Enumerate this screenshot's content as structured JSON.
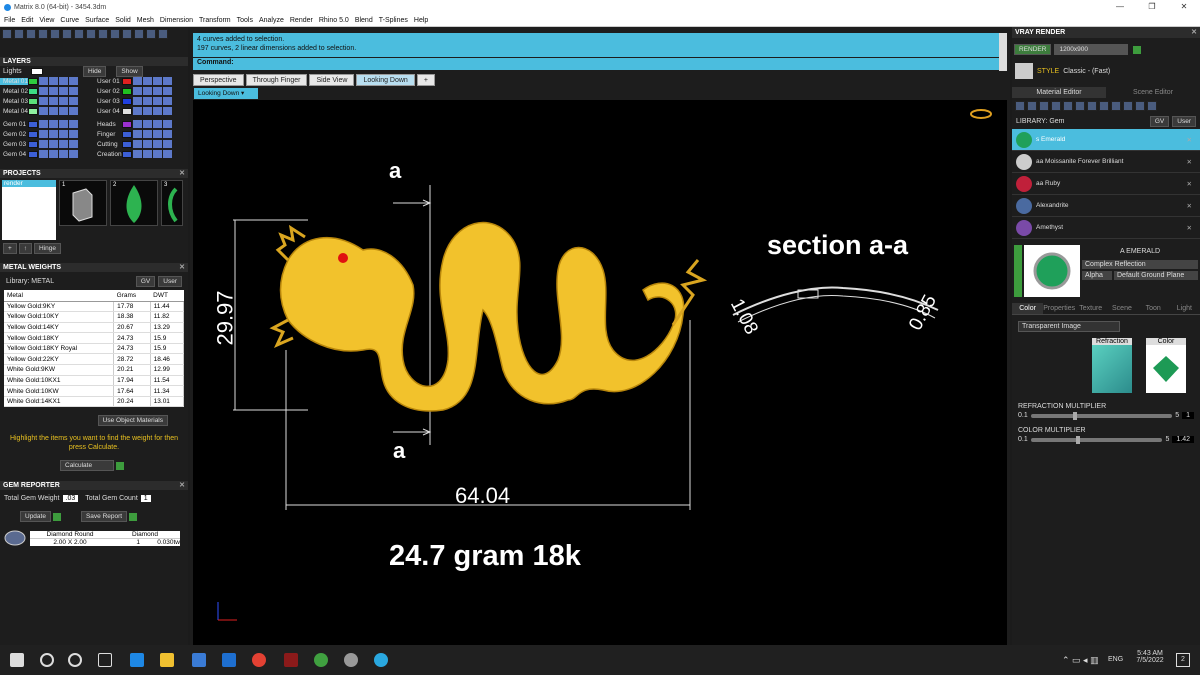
{
  "window": {
    "title": "Matrix 8.0 (64-bit) - 3454.3dm",
    "controls": [
      "—",
      "❐",
      "✕"
    ]
  },
  "menu": [
    "File",
    "Edit",
    "View",
    "Curve",
    "Surface",
    "Solid",
    "Mesh",
    "Dimension",
    "Transform",
    "Tools",
    "Analyze",
    "Render",
    "Rhino 5.0",
    "Blend",
    "T-Splines",
    "Help"
  ],
  "layers": {
    "title": "LAYERS",
    "lights_label": "Lights",
    "hide_label": "Hide",
    "show_label": "Show",
    "left": [
      {
        "name": "Metal 01",
        "color": "#2ecc40"
      },
      {
        "name": "Metal 02",
        "color": "#3ddc84"
      },
      {
        "name": "Metal 03",
        "color": "#5be07a"
      },
      {
        "name": "Metal 04",
        "color": "#8ff0a0"
      },
      {
        "name": "Gem 01",
        "color": "#3c5fd6"
      },
      {
        "name": "Gem 02",
        "color": "#3c5fd6"
      },
      {
        "name": "Gem 03",
        "color": "#3c5fd6"
      },
      {
        "name": "Gem 04",
        "color": "#3c5fd6"
      }
    ],
    "right": [
      {
        "name": "User 01",
        "color": "#e02020"
      },
      {
        "name": "User 02",
        "color": "#20c020"
      },
      {
        "name": "User 03",
        "color": "#2040e0"
      },
      {
        "name": "User 04",
        "color": "#e0e0e0"
      },
      {
        "name": "Heads",
        "color": "#9b30d0"
      },
      {
        "name": "Finger",
        "color": "#3c5fd6"
      },
      {
        "name": "Cutting",
        "color": "#3c5fd6"
      },
      {
        "name": "Creation",
        "color": "#3c5fd6"
      }
    ]
  },
  "projects": {
    "title": "PROJECTS",
    "item": "render",
    "thumbs": [
      "1",
      "2",
      "3"
    ],
    "hinge_label": "Hinge"
  },
  "metal_weights": {
    "title": "METAL WEIGHTS",
    "library_label": "Library: METAL",
    "gv_label": "GV",
    "user_label": "User",
    "columns": [
      "Metal",
      "Grams",
      "DWT"
    ],
    "rows": [
      [
        "Yellow Gold:9KY",
        "17.78",
        "11.44"
      ],
      [
        "Yellow Gold:10KY",
        "18.38",
        "11.82"
      ],
      [
        "Yellow Gold:14KY",
        "20.67",
        "13.29"
      ],
      [
        "Yellow Gold:18KY",
        "24.73",
        "15.9"
      ],
      [
        "Yellow Gold:18KY Royal",
        "24.73",
        "15.9"
      ],
      [
        "Yellow Gold:22KY",
        "28.72",
        "18.46"
      ],
      [
        "White Gold:9KW",
        "20.21",
        "12.99"
      ],
      [
        "White Gold:10KX1",
        "17.94",
        "11.54"
      ],
      [
        "White Gold:10KW",
        "17.64",
        "11.34"
      ],
      [
        "White Gold:14KX1",
        "20.24",
        "13.01"
      ]
    ],
    "use_object_materials": "Use Object Materials",
    "hint": "Highlight the items you want to find the weight for then press Calculate.",
    "calculate_label": "Calculate"
  },
  "gem_reporter": {
    "title": "GEM REPORTER",
    "total_weight_label": "Total Gem Weight",
    "total_weight_value": ".03",
    "total_count_label": "Total Gem Count",
    "total_count_value": "1",
    "update_label": "Update",
    "save_report_label": "Save Report",
    "gem": {
      "name": "Diamond Round",
      "type": "Diamond",
      "size": "2.00 X 2.00",
      "qty": "1",
      "weight": "0.030tw"
    }
  },
  "command": {
    "messages": [
      "4 curves added to selection.",
      "197 curves, 2 linear dimensions added to selection."
    ],
    "label": "Command:"
  },
  "viewport_tabs": [
    "Perspective",
    "Through Finger",
    "Side View",
    "Looking Down"
  ],
  "active_tab_index": 3,
  "viewport_label": "Looking Down",
  "drawing": {
    "label_a_top": "a",
    "label_a_bottom": "a",
    "height_dim": "29.97",
    "width_dim": "64.04",
    "section_title": "section a-a",
    "section_left_dim": "1.08",
    "section_right_dim": "0.85",
    "caption": "24.7 gram 18k",
    "dragon_color": "#f2c22c",
    "eye_color": "#e01010"
  },
  "vray": {
    "title": "VRAY RENDER",
    "render_label": "RENDER",
    "resolution": "1200x900",
    "style_label": "STYLE",
    "style_value": "Classic - (Fast)",
    "tabs": [
      "Material Editor",
      "Scene Editor"
    ],
    "library_label": "LIBRARY: Gem",
    "materials": [
      {
        "name": "s Emerald",
        "color": "#1fa05a",
        "selected": true
      },
      {
        "name": "aa Moissanite Forever Brilliant",
        "color": "#cccccc",
        "selected": false
      },
      {
        "name": "aa Ruby",
        "color": "#c0203a",
        "selected": false
      },
      {
        "name": "Alexandrite",
        "color": "#4a6aa0",
        "selected": false
      },
      {
        "name": "Amethyst",
        "color": "#7a4aa8",
        "selected": false
      }
    ],
    "selected_material": "A EMERALD",
    "reflection_type": "Complex Reflection",
    "alpha_label": "Alpha",
    "ground_plane": "Default Ground Plane",
    "prop_tabs": [
      "Color",
      "Properties",
      "Texture",
      "Scene",
      "Toon",
      "Light"
    ],
    "transparent_image": "Transparent Image",
    "refraction_label": "Refraction",
    "color_label": "Color",
    "refraction_multiplier_label": "REFRACTION MULTIPLIER",
    "refraction_min": "0.1",
    "refraction_max": "5",
    "refraction_value": "1",
    "color_multiplier_label": "COLOR MULTIPLIER",
    "color_min": "0.1",
    "color_max": "5",
    "color_value": "1.42"
  },
  "taskbar": {
    "lang": "ENG",
    "time": "5:43 AM",
    "date": "7/5/2022",
    "notif": "2"
  }
}
